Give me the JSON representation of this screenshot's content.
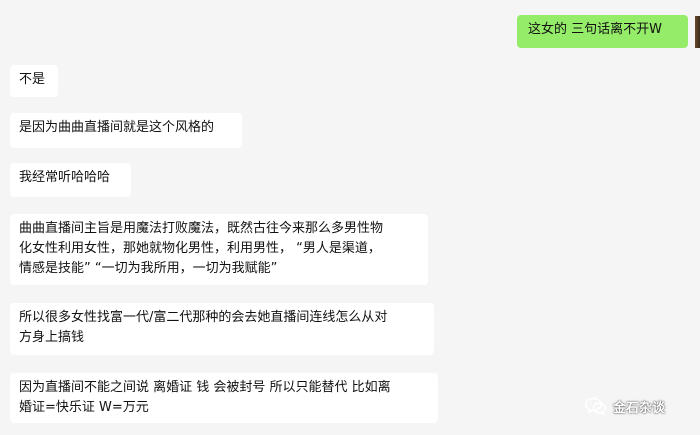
{
  "chat": {
    "outgoing": [
      {
        "lines": [
          "这女的 三句话离不开W"
        ]
      }
    ],
    "incoming": [
      {
        "lines": [
          "不是"
        ]
      },
      {
        "lines": [
          "是因为曲曲直播间就是这个风格的"
        ]
      },
      {
        "lines": [
          "我经常听哈哈哈"
        ]
      },
      {
        "lines": [
          "曲曲直播间主旨是用魔法打败魔法，既然古往今来那么多男性物",
          "化女性利用女性，那她就物化男性，利用男性， “男人是渠道，",
          "情感是技能”  “一切为我所用，一切为我赋能”"
        ]
      },
      {
        "lines": [
          "所以很多女性找富一代/富二代那种的会去她直播间连线怎么从对",
          "方身上搞钱"
        ]
      },
      {
        "lines": [
          "因为直播间不能之间说 离婚证 钱 会被封号 所以只能替代 比如离",
          "婚证=快乐证 W=万元"
        ]
      }
    ]
  },
  "watermark": {
    "text": "金石杂谈",
    "icon": "wechat-icon"
  },
  "colors": {
    "background": "#f5f5f5",
    "incoming_bubble": "#ffffff",
    "outgoing_bubble": "#95ec69",
    "text": "#111111"
  }
}
